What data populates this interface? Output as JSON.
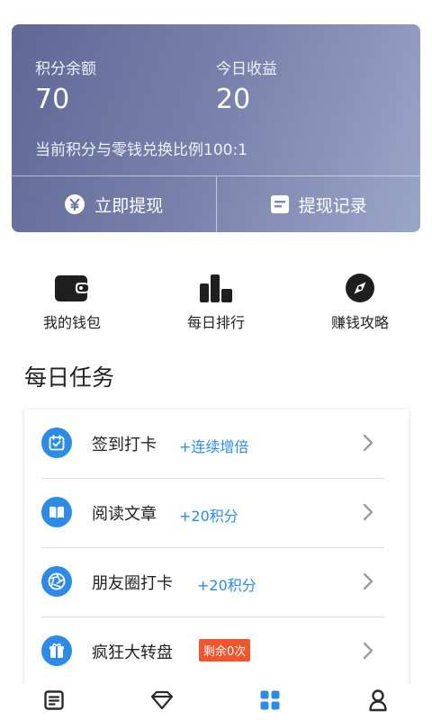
{
  "points": {
    "balance_label": "积分余额",
    "balance_value": "70",
    "today_label": "今日收益",
    "today_value": "20",
    "rate_text": "当前积分与零钱兑换比例100:1",
    "withdraw_label": "立即提现",
    "withdraw_icon": "yen-icon",
    "records_label": "提现记录",
    "records_icon": "record-icon"
  },
  "shortcuts": [
    {
      "label": "我的钱包",
      "icon": "wallet-icon"
    },
    {
      "label": "每日排行",
      "icon": "bar-chart-icon"
    },
    {
      "label": "赚钱攻略",
      "icon": "compass-icon"
    }
  ],
  "section_title": "每日任务",
  "tasks": [
    {
      "name": "签到打卡",
      "reward": "+连续增倍",
      "icon": "calendar-check-icon"
    },
    {
      "name": "阅读文章",
      "reward": "+20积分",
      "icon": "book-icon"
    },
    {
      "name": "朋友圈打卡",
      "reward": "+20积分",
      "icon": "aperture-icon"
    },
    {
      "name": "疯狂大转盘",
      "badge": "剩余0次",
      "icon": "gift-icon"
    }
  ],
  "tabbar": [
    {
      "icon": "news-icon",
      "active": false
    },
    {
      "icon": "diamond-icon",
      "active": false
    },
    {
      "icon": "grid-icon",
      "active": true
    },
    {
      "icon": "person-icon",
      "active": false
    }
  ],
  "colors": {
    "accent": "#2d8be6",
    "badge": "#f0552e",
    "card_gradient_start": "#5f6797",
    "card_gradient_end": "#9aa6c8",
    "icon_dark": "#1f1f1f",
    "inactive_tab": "#2a2a2a"
  }
}
